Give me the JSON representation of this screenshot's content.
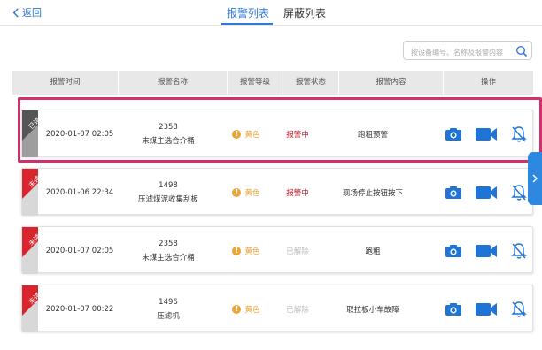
{
  "nav": {
    "back_label": "返回"
  },
  "tabs": [
    {
      "label": "报警列表",
      "active": true
    },
    {
      "label": "屏蔽列表",
      "active": false
    }
  ],
  "search": {
    "placeholder": "按设备编号、名称及报警内容"
  },
  "columns": [
    "报警时间",
    "报警名称",
    "报警等级",
    "报警状态",
    "报警内容",
    "操作"
  ],
  "rows": [
    {
      "badge": "已读",
      "badge_color": "#555555",
      "time": "2020-01-07 02:05",
      "code": "2358",
      "name": "末煤主选合介桶",
      "level": "黄色",
      "status": "报警中",
      "status_type": "active",
      "content": "跑粗预警"
    },
    {
      "badge": "未读",
      "badge_color": "#d9232d",
      "time": "2020-01-06 22:34",
      "code": "1498",
      "name": "压滤煤泥收集刮板",
      "level": "黄色",
      "status": "报警中",
      "status_type": "active",
      "content": "现场停止按钮按下"
    },
    {
      "badge": "未读",
      "badge_color": "#d9232d",
      "time": "2020-01-07 02:05",
      "code": "2358",
      "name": "末煤主选合介桶",
      "level": "黄色",
      "status": "已解除",
      "status_type": "cleared",
      "content": "跑粗"
    },
    {
      "badge": "未读",
      "badge_color": "#d9232d",
      "time": "2020-01-07 00:22",
      "code": "1496",
      "name": "压滤机",
      "level": "黄色",
      "status": "已解除",
      "status_type": "cleared",
      "content": "取拉板小车故障"
    }
  ],
  "colors": {
    "accent": "#2f79d8",
    "alarm_active": "#c0182c",
    "level_yellow": "#e8a33a",
    "highlight": "#d0306b"
  },
  "icons": [
    "back-chevron-icon",
    "search-icon",
    "camera-icon",
    "video-icon",
    "bell-off-icon",
    "side-expand-icon"
  ]
}
